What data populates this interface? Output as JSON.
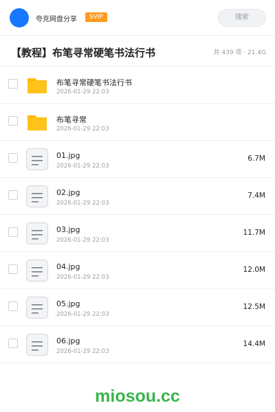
{
  "header": {
    "brand": "夸克网盘分享",
    "badge": "SVIP",
    "search_placeholder": "搜索",
    "avatar_color": "#1677ff",
    "badge_color": "#ff9a1f"
  },
  "folder": {
    "title": "【教程】布笔寻常硬笔书法行书",
    "summary": "共 439 项 · 21.4G"
  },
  "files": [
    {
      "name": "布笔寻常硬笔书法行书",
      "date": "2026-01-29 22:03",
      "size": "",
      "icon": "folder-icon"
    },
    {
      "name": "布笔寻常",
      "date": "2026-01-29 22:03",
      "size": "",
      "icon": "folder-icon"
    },
    {
      "name": "01.jpg",
      "date": "2026-01-29 22:03",
      "size": "6.7M",
      "icon": "file-icon"
    },
    {
      "name": "02.jpg",
      "date": "2026-01-29 22:03",
      "size": "7.4M",
      "icon": "file-icon"
    },
    {
      "name": "03.jpg",
      "date": "2026-01-29 22:03",
      "size": "11.7M",
      "icon": "file-icon"
    },
    {
      "name": "04.jpg",
      "date": "2026-01-29 22:03",
      "size": "12.0M",
      "icon": "file-icon"
    },
    {
      "name": "05.jpg",
      "date": "2026-01-29 22:03",
      "size": "12.5M",
      "icon": "file-icon"
    },
    {
      "name": "06.jpg",
      "date": "2026-01-29 22:03",
      "size": "14.4M",
      "icon": "file-icon"
    }
  ],
  "watermark": "miosou.cc",
  "colors": {
    "folder": "#ffc21a",
    "watermark": "#39b54a"
  }
}
